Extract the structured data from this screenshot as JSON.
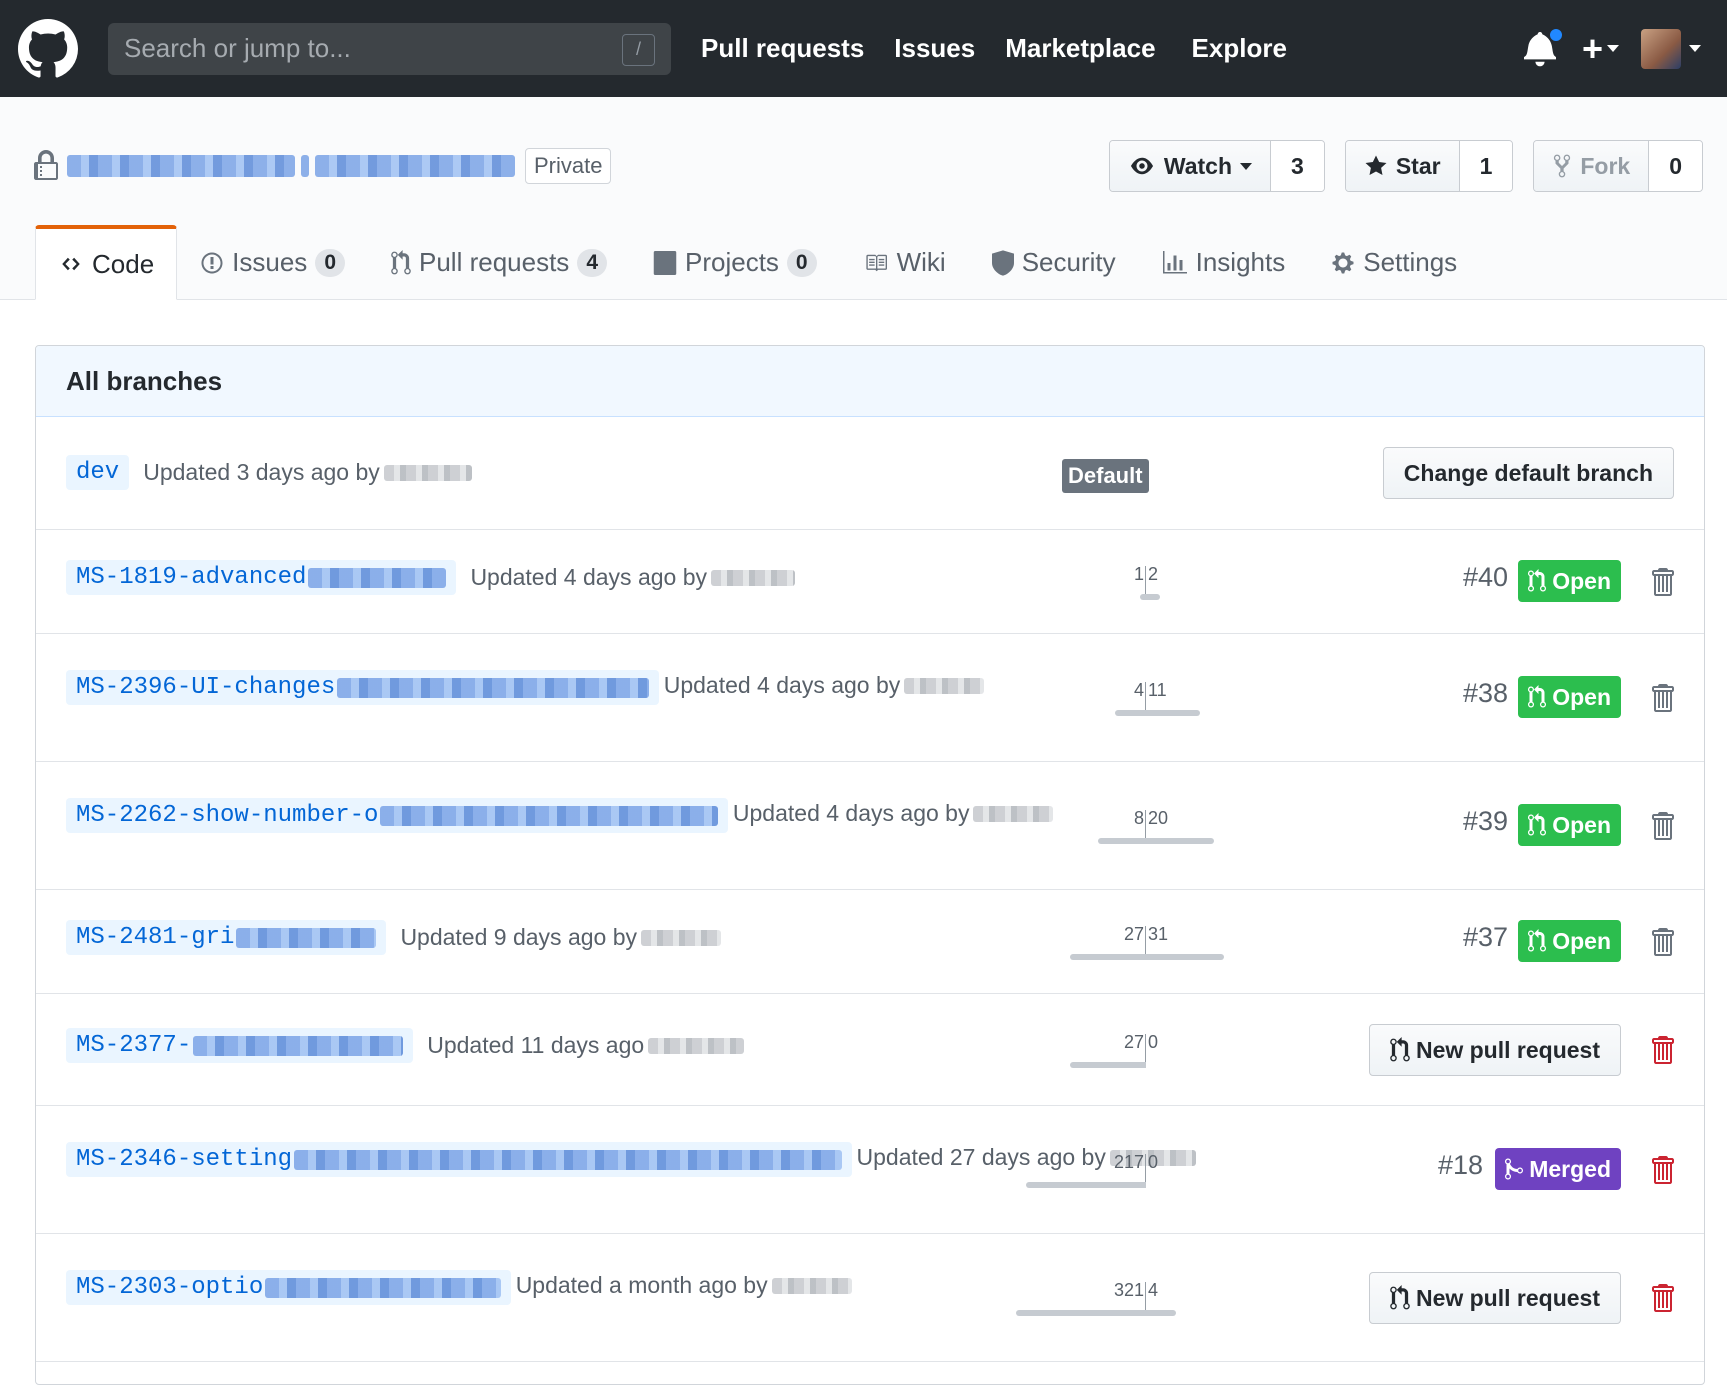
{
  "header": {
    "search_placeholder": "Search or jump to...",
    "slash_hint": "/",
    "nav": [
      "Pull requests",
      "Issues",
      "Marketplace",
      "Explore"
    ]
  },
  "repo": {
    "visibility": "Private",
    "watch": {
      "label": "Watch",
      "count": "3"
    },
    "star": {
      "label": "Star",
      "count": "1"
    },
    "fork": {
      "label": "Fork",
      "count": "0"
    }
  },
  "tabs": [
    {
      "label": "Code"
    },
    {
      "label": "Issues",
      "count": "0"
    },
    {
      "label": "Pull requests",
      "count": "4"
    },
    {
      "label": "Projects",
      "count": "0"
    },
    {
      "label": "Wiki"
    },
    {
      "label": "Security"
    },
    {
      "label": "Insights"
    },
    {
      "label": "Settings"
    }
  ],
  "branches": {
    "title": "All branches",
    "default_label": "Default",
    "change_default_label": "Change default branch",
    "new_pr_label": "New pull request",
    "rows": [
      {
        "name": "dev",
        "updated": "Updated 3 days ago by"
      },
      {
        "name": "MS-1819-advanced",
        "updated": "Updated 4 days ago by",
        "behind": "1",
        "ahead": "2",
        "pr": "#40",
        "state": "Open"
      },
      {
        "name": "MS-2396-UI-changes",
        "updated": "Updated 4 days ago by",
        "behind": "4",
        "ahead": "11",
        "pr": "#38",
        "state": "Open"
      },
      {
        "name": "MS-2262-show-number-o",
        "updated": "Updated 4 days ago by",
        "behind": "8",
        "ahead": "20",
        "pr": "#39",
        "state": "Open"
      },
      {
        "name": "MS-2481-gri",
        "updated": "Updated 9 days ago by",
        "behind": "27",
        "ahead": "31",
        "pr": "#37",
        "state": "Open"
      },
      {
        "name": "MS-2377-",
        "updated": "Updated 11 days ago",
        "behind": "27",
        "ahead": "0"
      },
      {
        "name": "MS-2346-setting",
        "updated": "Updated 27 days ago by",
        "behind": "217",
        "ahead": "0",
        "pr": "#18",
        "state": "Merged"
      },
      {
        "name": "MS-2303-optio",
        "updated": "Updated a month ago by",
        "behind": "321",
        "ahead": "4"
      }
    ]
  },
  "colors": {
    "header_bg": "#24292e",
    "open": "#2cbe4e",
    "merged": "#6f42c1",
    "link": "#0366d6",
    "tab_accent": "#e36209",
    "danger": "#cb2431"
  }
}
